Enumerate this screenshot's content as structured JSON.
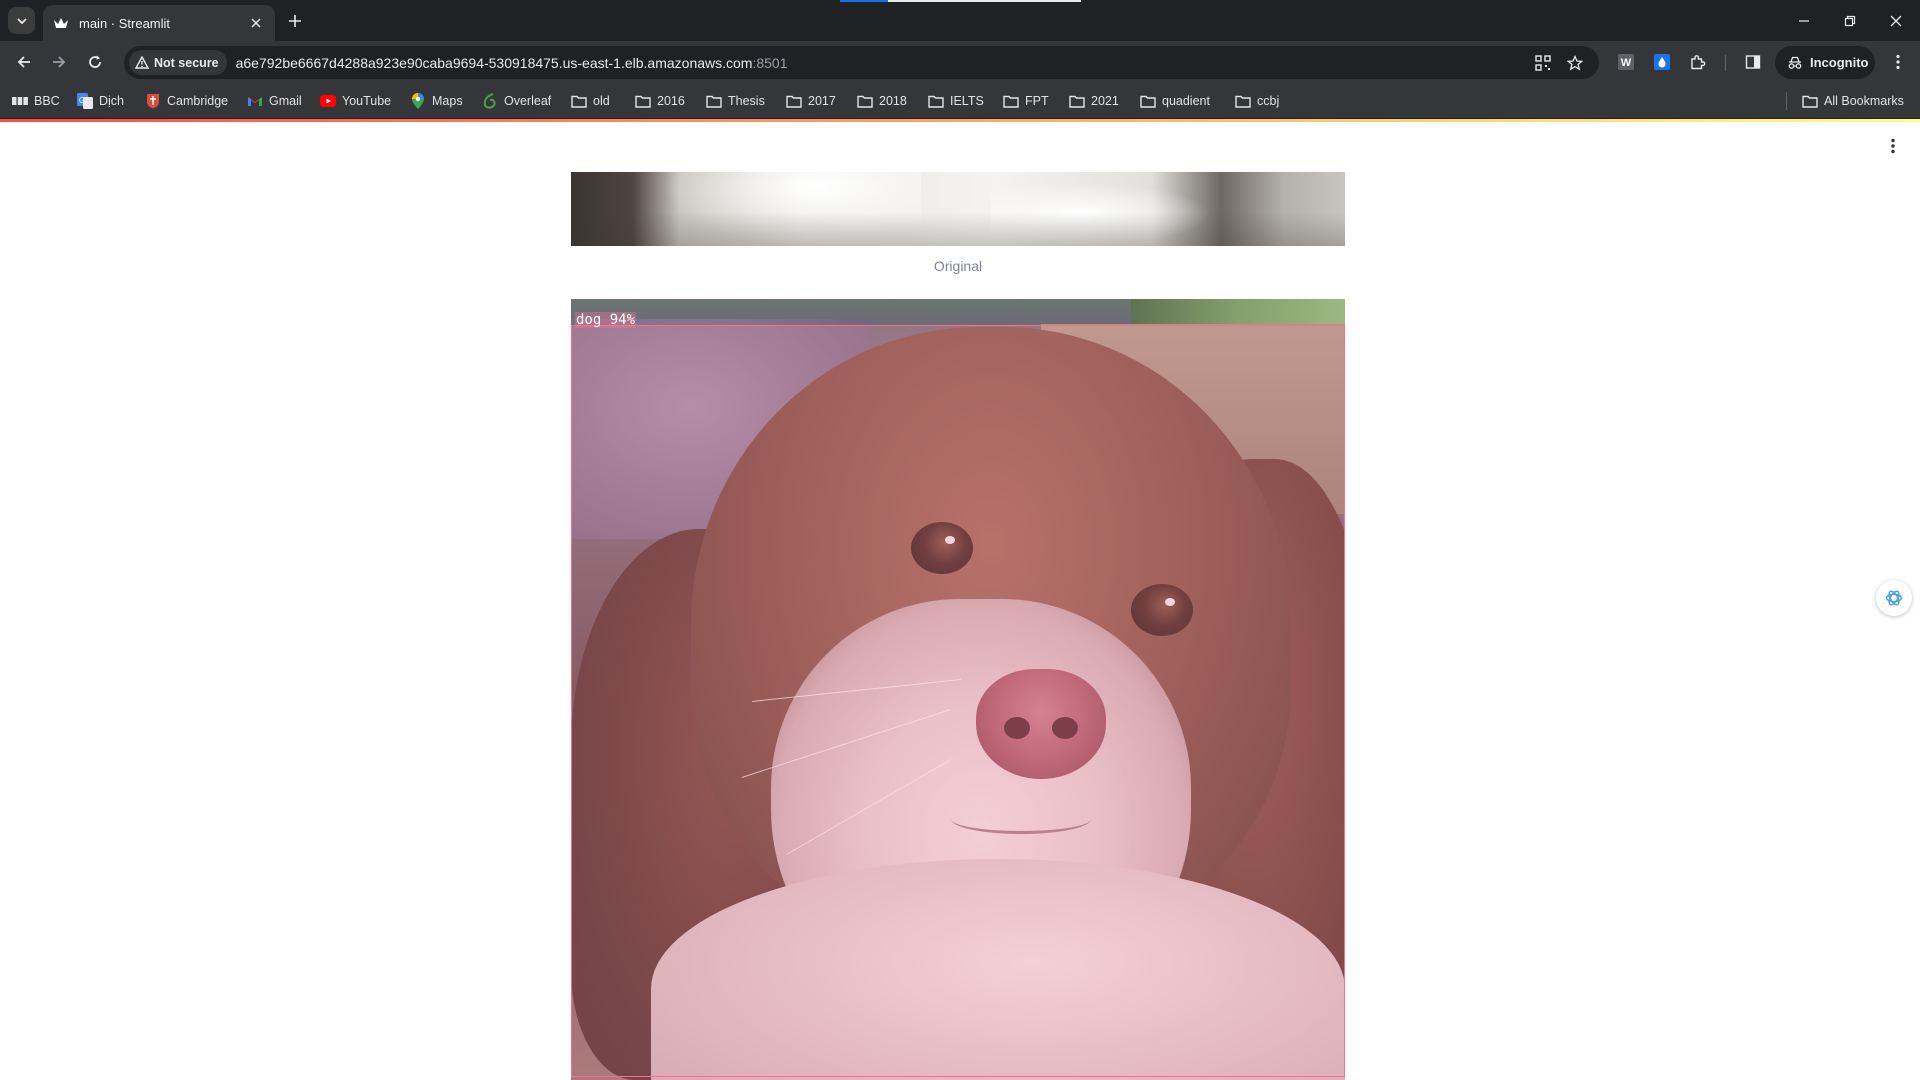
{
  "browser": {
    "tab": {
      "title": "main · Streamlit"
    },
    "address": {
      "security_label": "Not secure",
      "url_host": "a6e792be6667d4288a923e90caba9694-530918475.us-east-1.elb.amazonaws.com",
      "url_port": ":8501"
    },
    "profile": {
      "label": "Incognito"
    },
    "extensions": [
      {
        "icon": "w-extension-icon",
        "label": "W"
      }
    ],
    "bookmarks": [
      {
        "label": "BBC",
        "icon": "bbc-icon"
      },
      {
        "label": "Dịch",
        "icon": "translate-icon"
      },
      {
        "label": "Cambridge",
        "icon": "cambridge-icon"
      },
      {
        "label": "Gmail",
        "icon": "gmail-icon"
      },
      {
        "label": "YouTube",
        "icon": "youtube-icon"
      },
      {
        "label": "Maps",
        "icon": "maps-icon"
      },
      {
        "label": "Overleaf",
        "icon": "overleaf-icon"
      },
      {
        "label": "old",
        "icon": "folder-icon"
      },
      {
        "label": "2016",
        "icon": "folder-icon"
      },
      {
        "label": "Thesis",
        "icon": "folder-icon"
      },
      {
        "label": "2017",
        "icon": "folder-icon"
      },
      {
        "label": "2018",
        "icon": "folder-icon"
      },
      {
        "label": "IELTS",
        "icon": "folder-icon"
      },
      {
        "label": "FPT",
        "icon": "folder-icon"
      },
      {
        "label": "2021",
        "icon": "folder-icon"
      },
      {
        "label": "quadient",
        "icon": "folder-icon"
      },
      {
        "label": "ccbj",
        "icon": "folder-icon"
      }
    ],
    "all_bookmarks_label": "All Bookmarks"
  },
  "app": {
    "original_caption": "Original",
    "detection": {
      "label": "dog 94%",
      "class": "dog",
      "confidence": 0.94
    },
    "colors": {
      "bbox": "#ff6b8a",
      "mask": "#ff96aa",
      "decoration_start": "#ff4b4b",
      "decoration_end": "#fffd80"
    }
  }
}
